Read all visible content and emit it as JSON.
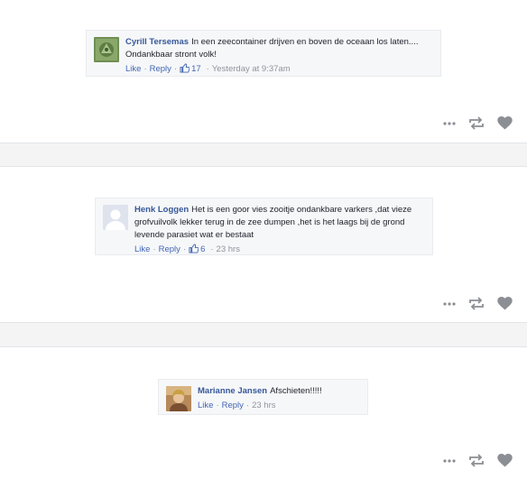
{
  "comments": [
    {
      "author": "Cyrill Tersemas",
      "text": "In een zeecontainer drijven en boven de oceaan los laten.... Ondankbaar stront volk!",
      "like_label": "Like",
      "reply_label": "Reply",
      "likes": "17",
      "time": "Yesterday at 9:37am",
      "avatar": "green-emblem-avatar"
    },
    {
      "author": "Henk Loggen",
      "text": "Het is een goor vies zooitje ondankbare varkers ,dat vieze grofvuilvolk lekker terug in de zee dumpen ,het is het laags bij de grond levende parasiet wat er bestaat",
      "like_label": "Like",
      "reply_label": "Reply",
      "likes": "6",
      "time": "23 hrs",
      "avatar": "default-silhouette-avatar"
    },
    {
      "author": "Marianne Jansen",
      "text": "Afschieten!!!!!",
      "like_label": "Like",
      "reply_label": "Reply",
      "likes": "",
      "time": "23 hrs",
      "avatar": "photo-avatar"
    }
  ],
  "post_actions": {
    "icons": [
      "more-options-icon",
      "repost-icon",
      "heart-icon"
    ],
    "icon_color": "#8b8e93"
  },
  "colors": {
    "author": "#365899",
    "link": "#4267b2",
    "meta": "#90949c",
    "comment_bg": "#f6f7f9"
  }
}
